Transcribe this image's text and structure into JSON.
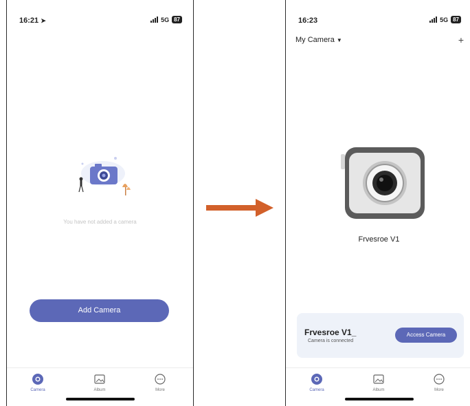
{
  "left_screen": {
    "status": {
      "time": "16:21",
      "network": "5G",
      "battery": "87"
    },
    "empty_message": "You have not added a camera",
    "add_button": "Add Camera",
    "tabs": [
      {
        "label": "Camera"
      },
      {
        "label": "Album"
      },
      {
        "label": "More"
      }
    ]
  },
  "right_screen": {
    "status": {
      "time": "16:23",
      "network": "5G",
      "battery": "87"
    },
    "header_title": "My Camera",
    "header_add": "+",
    "camera_name": "Frvesroe V1",
    "card": {
      "title": "Frvesroe V1_",
      "status": "Camera is connected",
      "button": "Access Camera"
    },
    "tabs": [
      {
        "label": "Camera"
      },
      {
        "label": "Album"
      },
      {
        "label": "More"
      }
    ]
  },
  "colors": {
    "accent": "#5c68b7",
    "arrow": "#d2602a",
    "card_bg": "#eef2f9"
  }
}
